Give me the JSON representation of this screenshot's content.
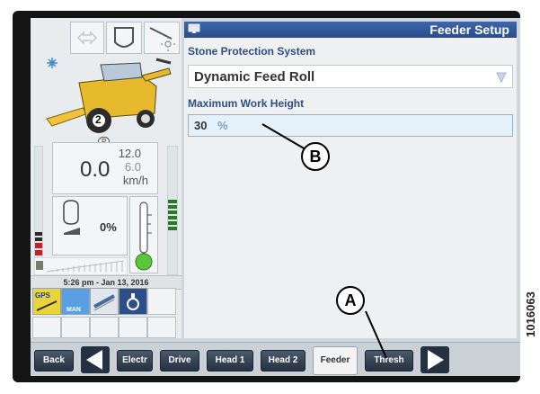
{
  "header": {
    "title": "Feeder Setup",
    "window_icon": "monitor-icon"
  },
  "fields": [
    {
      "label": "Stone Protection System",
      "value": "Dynamic Feed Roll",
      "control": "dropdown"
    },
    {
      "label": "Maximum Work Height",
      "value": "30",
      "unit": "%",
      "control": "input"
    }
  ],
  "status": {
    "speed": "0.0",
    "speed_max": "12.0",
    "speed_mid": "6.0",
    "speed_unit": "km/h",
    "fuel_percent": "0%",
    "datetime": "5:26 pm - Jan 13, 2016",
    "gear": "2",
    "park": "P",
    "mode_label": "MAN"
  },
  "nav": {
    "back": "Back",
    "tabs": [
      {
        "label": "Electr"
      },
      {
        "label": "Drive"
      },
      {
        "label": "Head 1"
      },
      {
        "label": "Head 2"
      },
      {
        "label": "Feeder",
        "active": true
      },
      {
        "label": "Thresh"
      }
    ]
  },
  "callouts": {
    "a": "A",
    "b": "B"
  },
  "figure_id": "1016063",
  "colors": {
    "titlebar": "#2f5596",
    "nav_button": "#2f3d4d",
    "field_highlight": "#e4f1fa",
    "accent_green": "#5cc63a",
    "alert_red": "#c8202a"
  }
}
